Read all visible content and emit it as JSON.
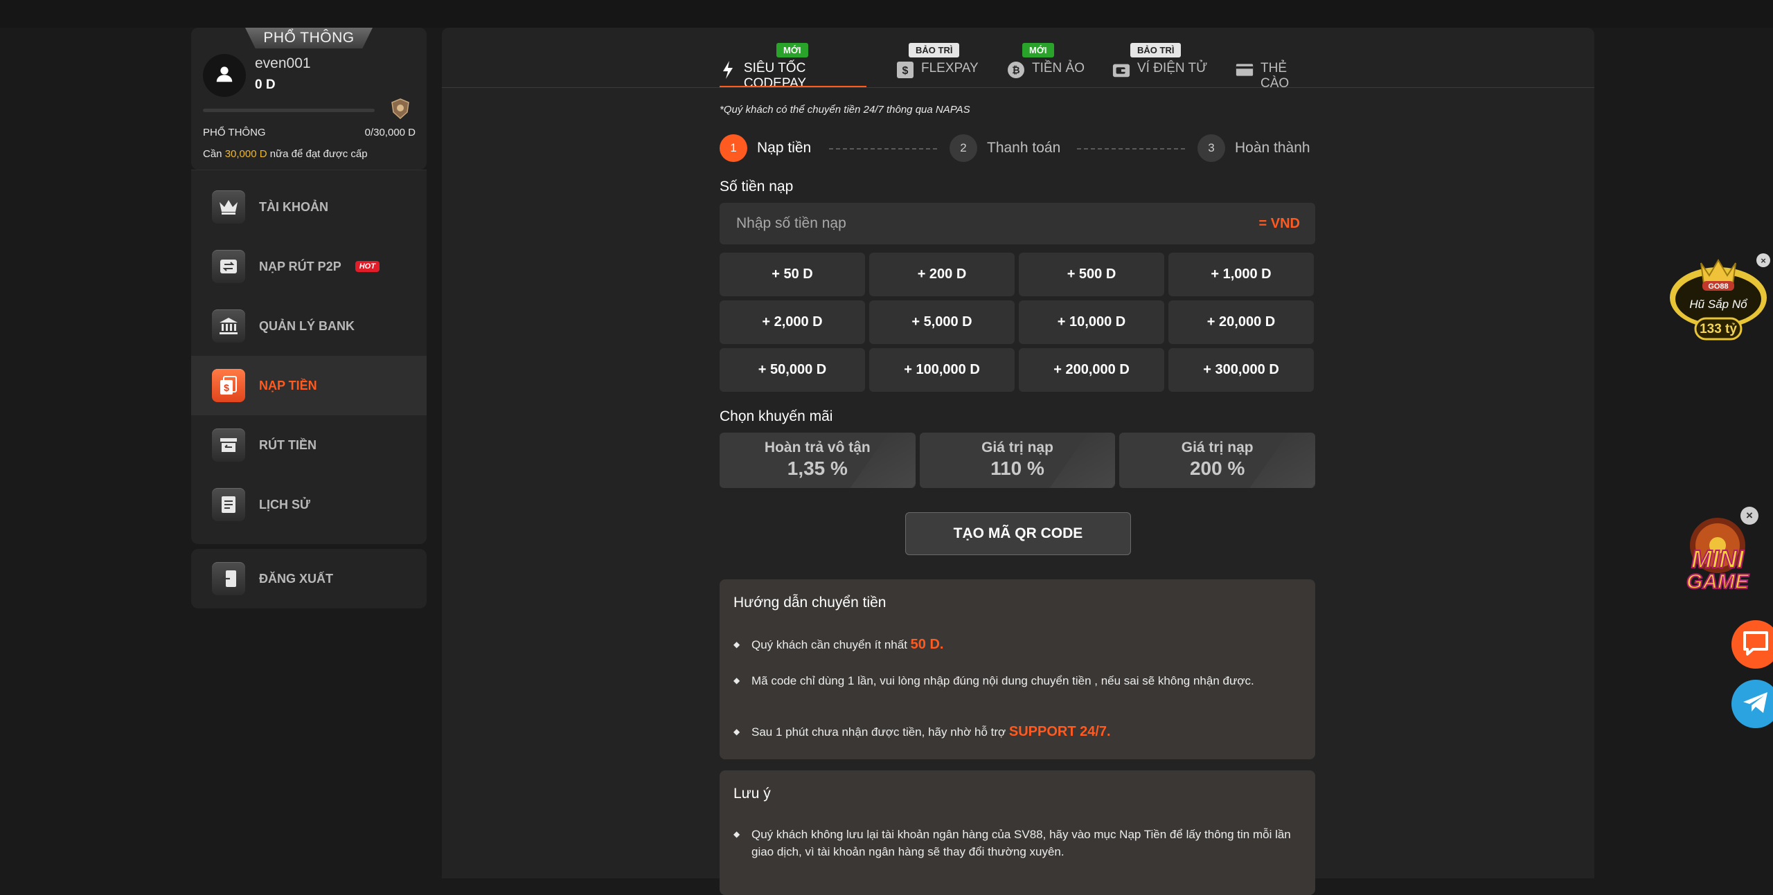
{
  "sidebar": {
    "tier_ribbon": "PHỔ THÔNG",
    "username": "even001",
    "balance": "0 D",
    "progress_fraction": 0.0,
    "tier_label": "PHỔ THÔNG",
    "tier_progress": "0/30,000 D",
    "need_prefix": "Cần ",
    "need_amount": "30,000 D",
    "need_suffix": " nữa để đạt được cấp",
    "menu": [
      {
        "label": "TÀI KHOẢN",
        "icon": "crown-icon"
      },
      {
        "label": "NẠP RÚT P2P",
        "icon": "transfer-icon",
        "badge": "HOT"
      },
      {
        "label": "QUẢN LÝ BANK",
        "icon": "bank-icon"
      },
      {
        "label": "NẠP TIỀN",
        "icon": "deposit-icon",
        "active": true
      },
      {
        "label": "RÚT TIỀN",
        "icon": "withdraw-icon"
      },
      {
        "label": "LỊCH SỬ",
        "icon": "history-icon"
      }
    ],
    "logout": "ĐĂNG XUẤT"
  },
  "tabs": [
    {
      "label": "SIÊU TỐC CODEPAY",
      "badge": "MỚI",
      "badge_type": "new",
      "icon": "lightning-icon",
      "active": true
    },
    {
      "label": "FLEXPAY",
      "badge": "BẢO TRÌ",
      "badge_type": "maint",
      "icon": "dollar-card-icon"
    },
    {
      "label": "TIỀN ẢO",
      "badge": "MỚI",
      "badge_type": "new",
      "icon": "bitcoin-icon"
    },
    {
      "label": "VÍ ĐIỆN TỬ",
      "badge": "BẢO TRÌ",
      "badge_type": "maint",
      "icon": "wallet-icon"
    },
    {
      "label": "THẺ CÀO",
      "icon": "card-icon"
    }
  ],
  "napas_note": "*Quý khách có thể chuyển tiền 24/7 thông qua NAPAS",
  "steps": [
    {
      "num": "1",
      "label": "Nạp tiền",
      "active": true
    },
    {
      "num": "2",
      "label": "Thanh toán"
    },
    {
      "num": "3",
      "label": "Hoàn thành"
    }
  ],
  "amount": {
    "title": "Số tiền nạp",
    "placeholder": "Nhập số tiền nạp",
    "value": "",
    "currency": "= VND",
    "quick_amounts": [
      "+ 50 D",
      "+ 200 D",
      "+ 500 D",
      "+ 1,000 D",
      "+ 2,000 D",
      "+ 5,000 D",
      "+ 10,000 D",
      "+ 20,000 D",
      "+ 50,000 D",
      "+ 100,000 D",
      "+ 200,000 D",
      "+ 300,000 D"
    ]
  },
  "promo": {
    "title": "Chọn khuyến mãi",
    "options": [
      {
        "title": "Hoàn trả vô tận",
        "value": "1,35 %"
      },
      {
        "title": "Giá trị nạp",
        "value": "110 %"
      },
      {
        "title": "Giá trị nạp",
        "value": "200 %"
      }
    ]
  },
  "qr_button": "TẠO MÃ QR CODE",
  "guide": {
    "title": "Hướng dẫn chuyển tiền",
    "b1_text": "Quý khách cần chuyển ít nhất ",
    "b1_hl": "50 D.",
    "b2_text": "Mã code chỉ dùng 1 lần, vui lòng nhập đúng nội dung chuyển tiền , nếu sai sẽ không nhận được.",
    "b3_text": "Sau 1 phút chưa nhận được tiền, hãy nhờ hỗ trợ ",
    "b3_hl": "SUPPORT 24/7."
  },
  "note": {
    "title": "Lưu ý",
    "b1_text": "Quý khách không lưu lại tài khoản ngân hàng của SV88, hãy vào mục Nạp Tiền để lấy thông tin mỗi lần giao dịch, vì tài khoản ngân hàng sẽ thay đổi thường xuyên."
  },
  "widgets": {
    "jackpot_brand": "GO88",
    "jackpot_label": "Hũ Sắp Nổ",
    "jackpot_value": "133 tỷ",
    "minigame_line1": "MINI",
    "minigame_line2": "GAME",
    "close_glyph": "×"
  },
  "colors": {
    "accent": "#ff5a1f",
    "new_badge": "#2aa32a",
    "maint_badge": "#e6e6e6",
    "gold": "#f0b72b",
    "telegram": "#2aa3e0"
  }
}
